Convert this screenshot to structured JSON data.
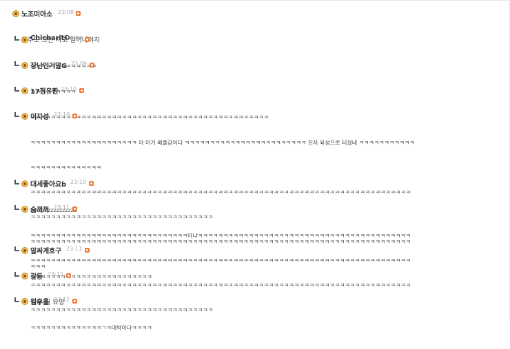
{
  "comments": [
    {
      "nick": "노조미아소",
      "time": "23:08",
      "reply": false,
      "lines": [
        "꼬추도 그만 자고 일어나야지"
      ],
      "big": true
    },
    {
      "nick": "ChicharitO",
      "time": "23:09",
      "reply": true,
      "lines": [
        "ㅋㅋㅋㅋㅋㅋㅋㅋㅋㅋㅋㅋㅋ"
      ]
    },
    {
      "nick": "장난인거알G",
      "time": "23:09",
      "reply": true,
      "lines": [
        "ㅋㅋㅋㅋㅋㅋㅋㅋㅋ"
      ]
    },
    {
      "nick": "17점유환",
      "time": "23:10",
      "reply": true,
      "lines": [
        "ㅋㅋㅋㅋㅋㅋㅋㅋㅋㅋㅋㅋㅋㅋㅋㅋㅋㅋㅋㅋㅋㅋㅋㅋㅋㅋㅋㅋㅋㅋㅋㅋㅋㅋㅋㅋㅋㅋㅋㅋㅋㅋㅋㅋㅋㅋㅋ"
      ]
    },
    {
      "nick": "이자성",
      "time": "23:10",
      "reply": true,
      "lines": [
        "ㅋㅋㅋㅋㅋㅋㅋㅋㅋㅋㅋㅋㅋㅋㅋㅋㅋㅋㅋㅋㅋ 아 이거 베플감이다 ㅋㅋㅋㅋㅋㅋㅋㅋㅋㅋㅋㅋㅋㅋㅋㅋㅋㅋㅋㅋㅋㅋㅋㅋ 진자 육성으로 터졌네 ㅋㅋㅋㅋㅋㅋㅋㅋㅋㅋㅋ",
        "ㅋㅋㅋㅋㅋㅋㅋㅋㅋㅋㅋㅋㅋㅋ",
        "ㅋㅋㅋㅋㅋㅋㅋㅋㅋㅋㅋㅋㅋㅋㅋㅋㅋㅋㅋㅋㅋㅋㅋㅋㅋㅋㅋㅋㅋㅋㅋㅋㅋㅋㅋㅋㅋㅋㅋㅋㅋㅋㅋㅋㅋㅋㅋㅋㅋㅋㅋㅋㅋㅋㅋㅋㅋㅋㅋㅋㅋㅋㅋㅋㅋㅋㅋㅋㅋㅋㅋㅋㅋㅋㅋ",
        "ㅋㅋㅋㅋㅋㅋㅋㅋㅋㅋㅋㅋㅋㅋㅋㅋㅋㅋㅋㅋㅋㅋㅋㅋㅋㅋㅋㅋㅋㅋㅋㅋㅋㅋㅋㅋ",
        "ㅋㅋㅋㅋㅋㅋㅋㅋㅋㅋㅋㅋㅋㅋㅋㅋㅋㅋㅋㅋㅋㅋㅋㅋㅋㅋㅋㅋㅋㅋㅋㅋㅋㅋㅋㅋㅋㅋㅋㅋㅋㅋㅋㅋㅋㅋㅋㅋㅋㅋㅋㅋㅋㅋㅋㅋㅋㅋㅋㅋㅋㅋㅋㅋㅋㅋㅋㅋㅋㅋㅋㅋㅋㅋㅋ",
        "ㅋㅋㅋ"
      ]
    },
    {
      "nick": "대세좋아요b",
      "time": "23:10",
      "reply": true,
      "lines": [
        "zzzzzzzzzzzzzzzz"
      ]
    },
    {
      "nick": "숨꺼꺼",
      "time": "23:11",
      "reply": true,
      "lines": [
        "ㅋㅋㅋㅋㅋㅋㅋㅋㅋㅋㅋㅋㅋㅋㅋㅋㅋㅋㅋㅋㅋㅋㅋㅋㅋㅋㅋㅋㅋㅋㅋ아냐ㅋㅋㅋㅋㅋㅋㅋㅋㅋㅋㅋㅋㅋㅋㅋㅋㅋㅋㅋㅋㅋㅋㅋㅋㅋㅋㅋㅋㅋㅋㅋㅋㅋㅋㅋㅋㅋㅋㅋㅋㅋㅋ",
        "ㅋㅋㅋㅋㅋㅋㅋㅋㅋㅋㅋㅋㅋㅋㅋㅋㅋㅋㅋㅋㅋㅋㅋㅋㅋㅋㅋㅋㅋㅋㅋㅋㅋㅋㅋㅋㅋㅋㅋㅋㅋㅋㅋㅋㅋㅋㅋㅋㅋㅋㅋㅋㅋㅋㅋㅋㅋㅋㅋㅋㅋㅋㅋㅋㅋㅋㅋㅋㅋㅋㅋㅋㅋㅋㅋ",
        "ㅋㅋㅋㅋㅋㅋㅋㅋㅋㅋㅋㅋㅋㅋㅋㅋㅋㅋㅋㅋㅋㅋㅋㅋㅋㅋㅋㅋㅋㅋㅋㅋㅋㅋㅋㅋㅋㅋㅋㅋㅋㅋㅋㅋㅋㅋㅋㅋㅋㅋㅋㅋㅋㅋㅋㅋㅋㅋㅋㅋㅋㅋㅋㅋㅋㅋㅋㅋㅋㅋㅋㅋㅋㅋㅋ",
        "ㅋㅋㅋㅋㅋㅋㅋㅋㅋㅋㅋㅋㅋㅋㅋㅋㅋㅋㅋㅋㅋㅋㅋㅋㅋㅋㅋㅋㅋㅋㅋㅋㅋㅋㅋㅋ"
      ]
    },
    {
      "nick": "알싸계호구",
      "time": "23:11",
      "reply": true,
      "lines": [
        "ㅋㅋㅋㅋㅋㅋㅋㅋㅋㅋㅋㅋㅋㅋㅋㅋㅋㅋㅋㅋㅋㅋㅋㅋ"
      ]
    },
    {
      "nick": "갈등",
      "time": "23:12",
      "reply": true,
      "lines": [
        "탑승 필 요망"
      ],
      "big": true
    },
    {
      "nick": "김우울",
      "time": "23:12",
      "reply": true,
      "lines": [
        "ㅋㅋㅋㅋㅋㅋㅋㅋㅋㅋㅋㅋㅋㅋㄱㅋ대박이다ㅋㅋㅋㅋ"
      ]
    }
  ]
}
